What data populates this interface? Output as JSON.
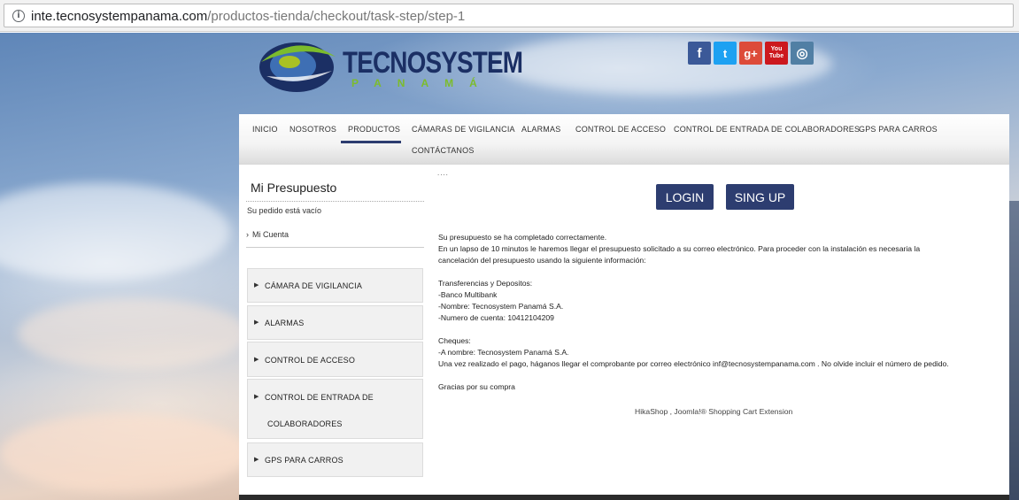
{
  "browser": {
    "url_domain": "inte.tecnosystempanama.com",
    "url_path": "/productos-tienda/checkout/task-step/step-1"
  },
  "header": {
    "logo_word": "TECNOSYSTEM",
    "logo_sub": "PANAMÁ",
    "social": [
      {
        "icon": "facebook-icon",
        "glyph": "f",
        "color": "#3b5998"
      },
      {
        "icon": "twitter-icon",
        "glyph": "t",
        "color": "#1da1f2"
      },
      {
        "icon": "google-plus-icon",
        "glyph": "g+",
        "color": "#dd4b39"
      },
      {
        "icon": "youtube-icon",
        "glyph": "You Tube",
        "color": "#cc181e"
      },
      {
        "icon": "instagram-icon",
        "glyph": "◎",
        "color": "#517fa4"
      }
    ]
  },
  "nav": {
    "items": [
      "INICIO",
      "NOSOTROS",
      "PRODUCTOS",
      "CÁMARAS DE VIGILANCIA",
      "ALARMAS",
      "CONTROL DE ACCESO",
      "CONTROL DE ENTRADA DE COLABORADORES",
      "GPS PARA CARROS",
      "CONTÁCTANOS"
    ],
    "active": "PRODUCTOS"
  },
  "sidebar": {
    "cart_title": "Mi Presupuesto",
    "cart_empty": "Su pedido está vacío",
    "account_link": "Mi Cuenta",
    "menu": [
      {
        "label": "CÁMARA DE VIGILANCIA"
      },
      {
        "label": "ALARMAS"
      },
      {
        "label": "CONTROL DE ACCESO"
      },
      {
        "label_line1": "CONTROL DE ENTRADA DE",
        "label_line2": "COLABORADORES"
      },
      {
        "label": "GPS PARA CARROS"
      }
    ]
  },
  "main": {
    "dots": "....",
    "login_label": "LOGIN",
    "signup_label": "SING UP",
    "lines": [
      "Su presupuesto se ha completado correctamente.",
      "En un lapso de 10 minutos le haremos llegar el presupuesto solicitado a su correo electrónico. Para proceder con la instalación es necesaria la",
      "cancelación del presupuesto usando la siguiente información:",
      "Transferencias y Depositos:",
      "-Banco Multibank",
      "-Nombre: Tecnosystem Panamá S.A.",
      "-Numero de cuenta: 10412104209",
      "Cheques:",
      "-A nombre: Tecnosystem Panamá S.A.",
      "Una vez realizado el pago, háganos llegar el comprobante por correo electrónico inf@tecnosystempanama.com . No olvide incluir el número de pedido.",
      "Gracias por su compra"
    ],
    "powered_by": "HikaShop , Joomla!® Shopping Cart Extension"
  },
  "colors": {
    "brand_navy": "#2d3d70",
    "brand_green": "#7cbc2c"
  }
}
